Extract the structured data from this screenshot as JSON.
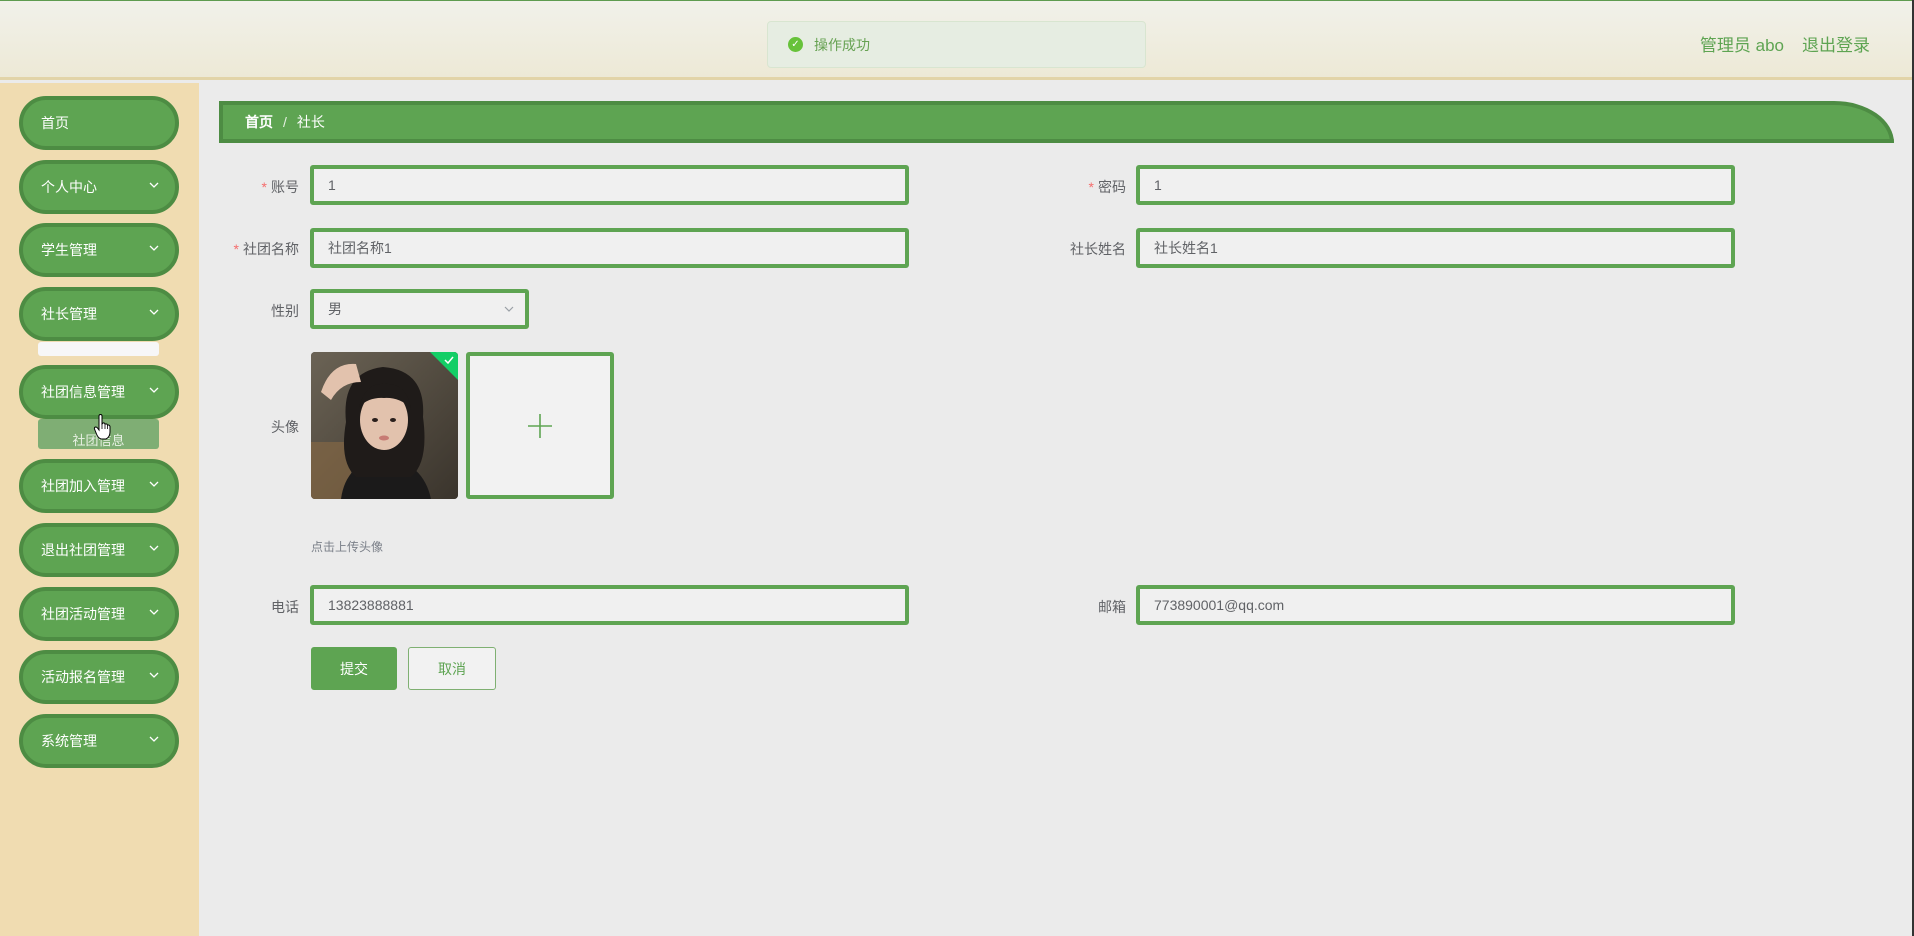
{
  "header": {
    "user": "管理员 abo",
    "logout": "退出登录"
  },
  "toast": {
    "message": "操作成功"
  },
  "sidebar": {
    "items": [
      {
        "label": "首页"
      },
      {
        "label": "个人中心"
      },
      {
        "label": "学生管理"
      },
      {
        "label": "社长管理"
      },
      {
        "label": "社团信息管理"
      },
      {
        "label": "社团加入管理"
      },
      {
        "label": "退出社团管理"
      },
      {
        "label": "社团活动管理"
      },
      {
        "label": "活动报名管理"
      },
      {
        "label": "系统管理"
      }
    ],
    "submenu_item": "社团信息"
  },
  "breadcrumb": {
    "home": "首页",
    "separator": "/",
    "current": "社长"
  },
  "form": {
    "account_label": "账号",
    "account_value": "1",
    "password_label": "密码",
    "password_value": "1",
    "club_name_label": "社团名称",
    "club_name_value": "社团名称1",
    "leader_name_label": "社长姓名",
    "leader_name_value": "社长姓名1",
    "gender_label": "性别",
    "gender_value": "男",
    "avatar_label": "头像",
    "avatar_hint": "点击上传头像",
    "phone_label": "电话",
    "phone_value": "13823888881",
    "email_label": "邮箱",
    "email_value": "773890001@qq.com",
    "required_mark": "*"
  },
  "buttons": {
    "submit": "提交",
    "cancel": "取消"
  },
  "colors": {
    "primary": "#5ea452",
    "primary_dark": "#4d8c43",
    "sidebar_bg": "#f0dcb1",
    "required": "#f56c6c",
    "success": "#67c23a"
  }
}
